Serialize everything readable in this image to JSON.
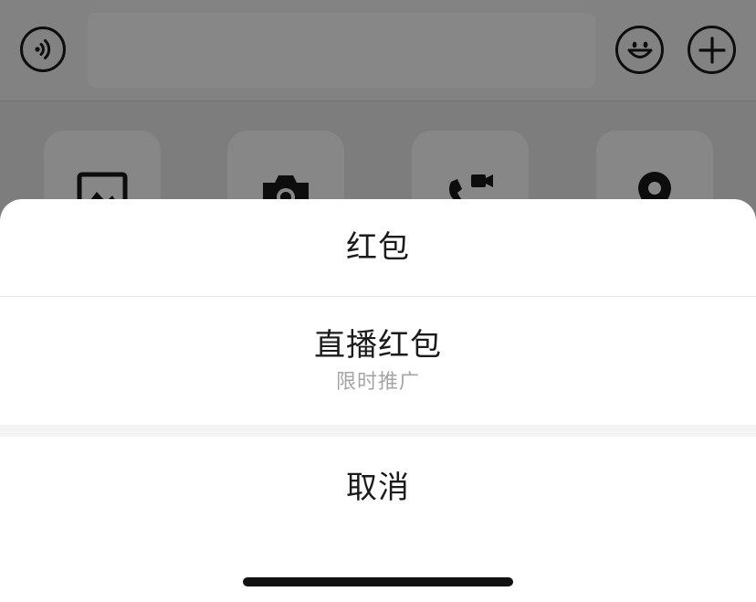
{
  "chat_input": {
    "text_value": ""
  },
  "toolbar": {
    "voice_icon": "voice-icon",
    "emoji_icon": "emoji-icon",
    "more_icon": "plus-icon"
  },
  "panel": {
    "tiles": [
      {
        "icon": "image-icon"
      },
      {
        "icon": "camera-icon"
      },
      {
        "icon": "video-call-icon"
      },
      {
        "icon": "location-icon"
      }
    ]
  },
  "action_sheet": {
    "items": [
      {
        "label": "红包"
      },
      {
        "label": "直播红包",
        "sublabel": "限时推广"
      }
    ],
    "cancel_label": "取消"
  },
  "colors": {
    "overlay": "#00000078",
    "sheet_bg": "#ffffff",
    "label": "#1b1b1b",
    "sublabel": "#a5a5a5"
  }
}
